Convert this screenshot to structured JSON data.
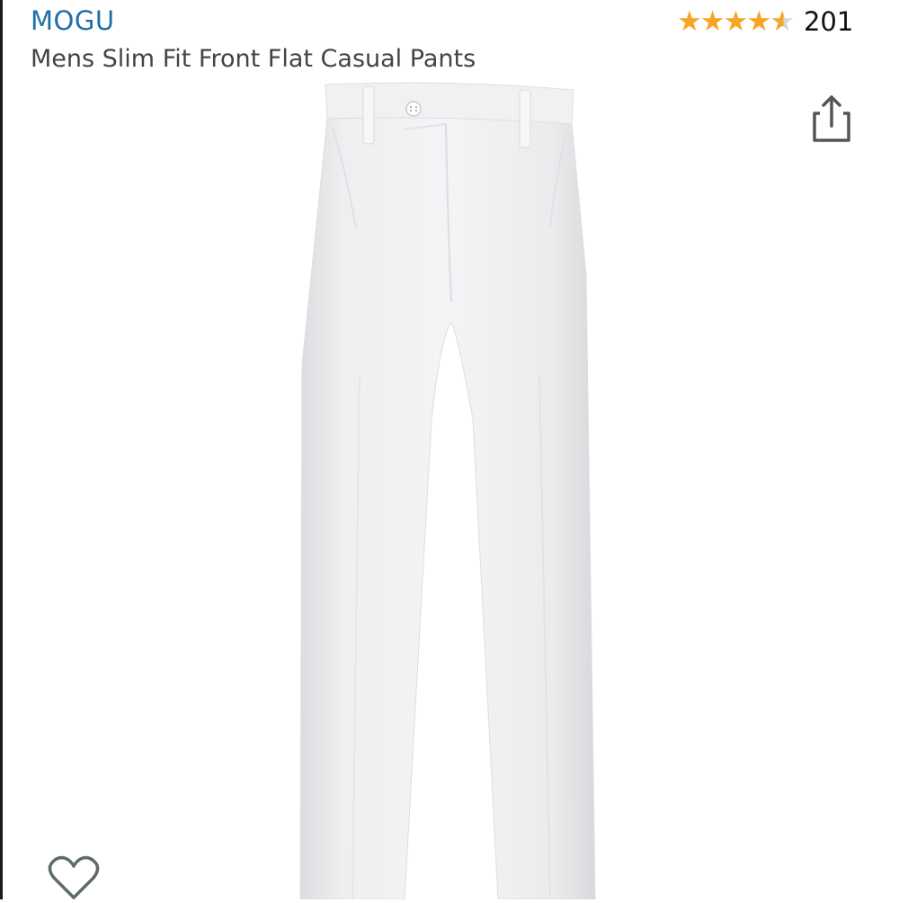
{
  "product": {
    "brand": "MOGU",
    "title": "Mens Slim Fit Front Flat Casual Pants",
    "rating": {
      "stars_out_of_5": 4.5,
      "count": "201"
    }
  },
  "icons": {
    "share": "share-icon",
    "wishlist": "heart-icon"
  },
  "colors": {
    "brand_link": "#1f6fa8",
    "star": "#f5a623",
    "star_empty": "#d6d6d6"
  }
}
